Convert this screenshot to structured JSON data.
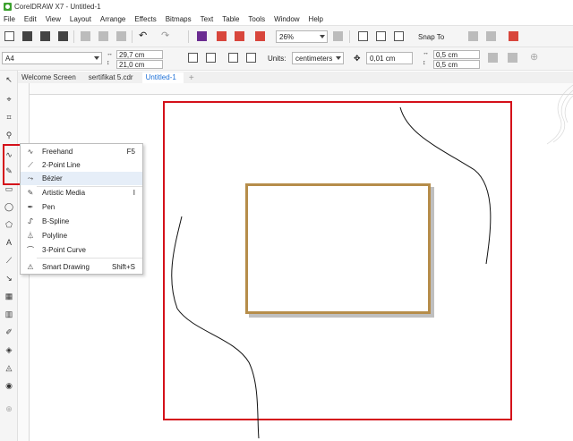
{
  "window": {
    "title": "CorelDRAW X7 - Untitled-1"
  },
  "menu": [
    "File",
    "Edit",
    "View",
    "Layout",
    "Arrange",
    "Effects",
    "Bitmaps",
    "Text",
    "Table",
    "Tools",
    "Window",
    "Help"
  ],
  "toolbar": {
    "zoom": "26%",
    "snap_to": "Snap To"
  },
  "property_bar": {
    "page_size": "A4",
    "width": "29,7 cm",
    "height": "21,0 cm",
    "units_label": "Units:",
    "units": "centimeters",
    "nudge": "0,01 cm",
    "duplicate_x": "0,5 cm",
    "duplicate_y": "0,5 cm"
  },
  "tabs": [
    "Welcome Screen",
    "sertifikat 5.cdr",
    "Untitled-1"
  ],
  "active_tab": "Untitled-1",
  "flyout": {
    "items": [
      {
        "icon": "freehand-icon",
        "label": "Freehand",
        "shortcut": "F5"
      },
      {
        "icon": "two-point-line-icon",
        "label": "2-Point Line",
        "shortcut": ""
      },
      {
        "icon": "bezier-icon",
        "label": "Bézier",
        "shortcut": ""
      },
      {
        "icon": "artistic-media-icon",
        "label": "Artistic Media",
        "shortcut": "I"
      },
      {
        "icon": "pen-icon",
        "label": "Pen",
        "shortcut": ""
      },
      {
        "icon": "b-spline-icon",
        "label": "B-Spline",
        "shortcut": ""
      },
      {
        "icon": "polyline-icon",
        "label": "Polyline",
        "shortcut": ""
      },
      {
        "icon": "three-point-curve-icon",
        "label": "3-Point Curve",
        "shortcut": ""
      },
      {
        "icon": "smart-drawing-icon",
        "label": "Smart Drawing",
        "shortcut": "Shift+S"
      }
    ]
  },
  "colors": {
    "highlight_red": "#d4101a",
    "frame_gold": "#b68d4a",
    "active_tab_blue": "#1d6fd6"
  }
}
